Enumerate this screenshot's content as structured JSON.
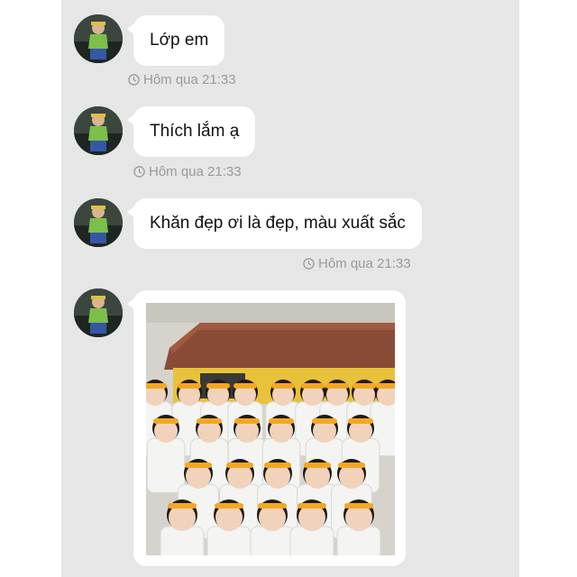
{
  "messages": [
    {
      "text": "Lớp em",
      "time": "Hôm qua 21:33"
    },
    {
      "text": "Thích lắm ạ",
      "time": "Hôm qua 21:33"
    },
    {
      "text": "Khăn đẹp ơi là đẹp, màu xuất sắc",
      "time": "Hôm qua 21:33"
    }
  ],
  "photo_message": {
    "image": "class-group-photo"
  },
  "icons": {
    "timestamp": "clock-icon",
    "avatar": "user-avatar"
  },
  "colors": {
    "panel_bg": "#e6e6e6",
    "bubble_bg": "#ffffff",
    "timestamp_text": "#9a9a9a",
    "headband": "#f3a722"
  }
}
